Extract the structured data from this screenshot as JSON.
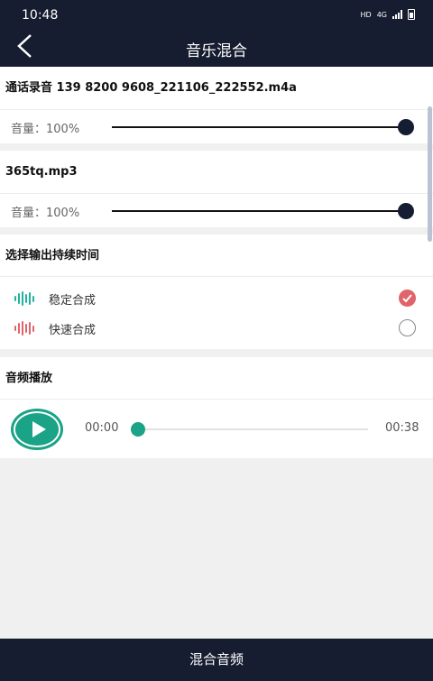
{
  "status_bar": {
    "time": "10:48",
    "network": "HD",
    "signal_type": "4G"
  },
  "header": {
    "title": "音乐混合",
    "back_icon": "chevron-left-icon"
  },
  "tracks": [
    {
      "name": "通话录音 139 8200 9608_221106_222552.m4a",
      "volume_label": "音量：100%",
      "volume_percent": 100
    },
    {
      "name": "365tq.mp3",
      "volume_label": "音量：100%",
      "volume_percent": 100
    }
  ],
  "duration_section": {
    "title": "选择输出持续时间",
    "options": [
      {
        "label": "稳定合成",
        "selected": true,
        "icon": "waveform-icon",
        "color": "#20b3a0"
      },
      {
        "label": "快速合成",
        "selected": false,
        "icon": "waveform-icon",
        "color": "#e06469"
      }
    ]
  },
  "playback_section": {
    "title": "音频播放",
    "current_time": "00:00",
    "total_time": "00:38",
    "progress_percent": 0,
    "play_icon": "play-icon"
  },
  "bottom_button": {
    "label": "混合音频"
  },
  "colors": {
    "primary": "#161d31",
    "accent_teal": "#1aa386",
    "accent_red": "#e06469"
  }
}
